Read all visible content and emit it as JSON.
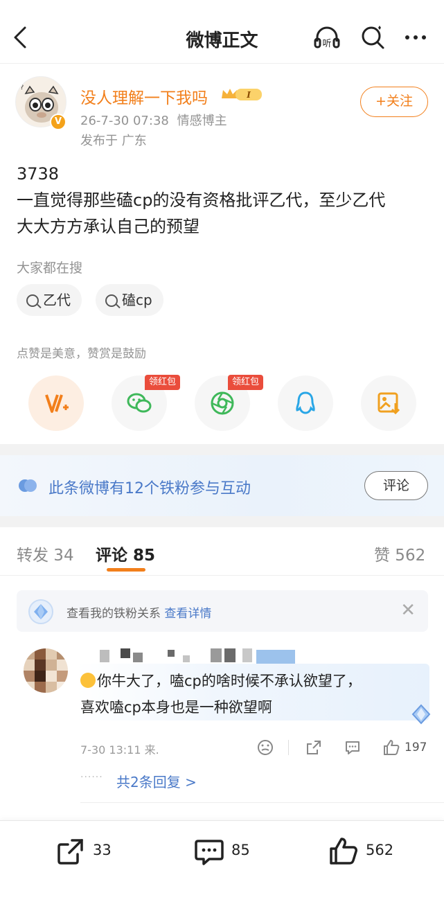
{
  "nav": {
    "title": "微博正文"
  },
  "post": {
    "username": "没人理解一下我吗",
    "member_level": "I",
    "timestamp": "26-7-30 07:38",
    "tag": "情感博主",
    "location": "发布于 广东",
    "follow_label": "+关注",
    "text_lines": [
      "3738",
      "一直觉得那些磕cp的没有资格批评乙代，至少乙代",
      "大大方方承认自己的预望"
    ]
  },
  "search": {
    "hint": "大家都在搜",
    "chips": [
      "乙代",
      "磕cp"
    ]
  },
  "reward": {
    "hint": "点赞是美意，赞赏是鼓励",
    "red_packet_label": "领红包",
    "share_targets": [
      "v-reward-icon",
      "wechat-icon",
      "moments-icon",
      "qq-icon",
      "save-image-icon"
    ]
  },
  "fans_banner": {
    "text": "此条微博有12个铁粉参与互动",
    "button": "评论"
  },
  "tabs": {
    "repost": "转发 34",
    "comments": "评论 85",
    "likes": "赞 562"
  },
  "fans_notice": {
    "text": "查看我的铁粉关系",
    "link": "查看详情"
  },
  "comment": {
    "text_lines": [
      "你牛大了，嗑cp的啥时候不承认欲望了，",
      "喜欢嗑cp本身也是一种欲望啊"
    ],
    "meta": "7-30 13:11 来.",
    "likes": "197",
    "replies": "共2条回复 >"
  },
  "bottom": {
    "repost_count": "33",
    "comment_count": "85",
    "like_count": "562"
  },
  "colors": {
    "accent": "#f27f1b",
    "link": "#4a79c8",
    "red_tag": "#ea4d3c"
  }
}
